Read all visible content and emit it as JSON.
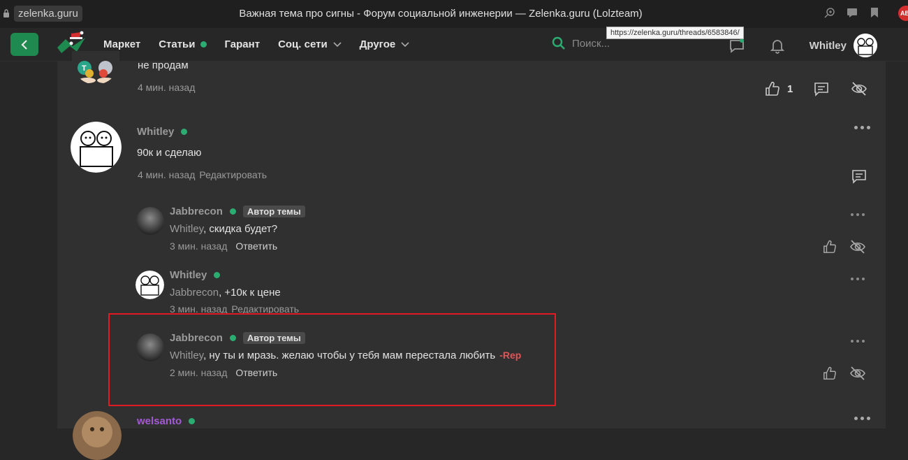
{
  "browser": {
    "address": "zelenka.guru",
    "window_title": "Важная тема про сигны - Форум социальной инженерии — Zelenka.guru (Lolzteam)",
    "tooltip_url": "https://zelenka.guru/threads/6583846/",
    "extension_badge": "AB"
  },
  "nav": {
    "items": [
      {
        "label": "Маркет"
      },
      {
        "label": "Статьи"
      },
      {
        "label": "Гарант"
      },
      {
        "label": "Соц. сети"
      },
      {
        "label": "Другое"
      }
    ],
    "search_placeholder": "Поиск...",
    "user": "Whitley"
  },
  "posts": [
    {
      "text": "не продам",
      "time": "4 мин. назад",
      "likes": "1"
    },
    {
      "author": "Whitley",
      "text": "90к и сделаю",
      "time": "4 мин. назад",
      "action": "Редактировать"
    }
  ],
  "comments": [
    {
      "author": "Jabbrecon",
      "badge": "Автор темы",
      "mention": "Whitley",
      "text": ", скидка будет?",
      "time": "3 мин. назад",
      "action": "Ответить"
    },
    {
      "author": "Whitley",
      "mention": "Jabbrecon",
      "text": ", +10к к цене",
      "time": "3 мин. назад",
      "action": "Редактировать"
    },
    {
      "author": "Jabbrecon",
      "badge": "Автор темы",
      "mention": "Whitley",
      "text": ", ну ты и мразь. желаю чтобы у тебя мам перестала любить",
      "rep": "-Rep",
      "time": "2 мин. назад",
      "action": "Ответить"
    }
  ],
  "next_post": {
    "author": "welsanto"
  },
  "colors": {
    "accent": "#2bad72",
    "highlight": "#e01b24",
    "next_author": "#a25ad6"
  }
}
